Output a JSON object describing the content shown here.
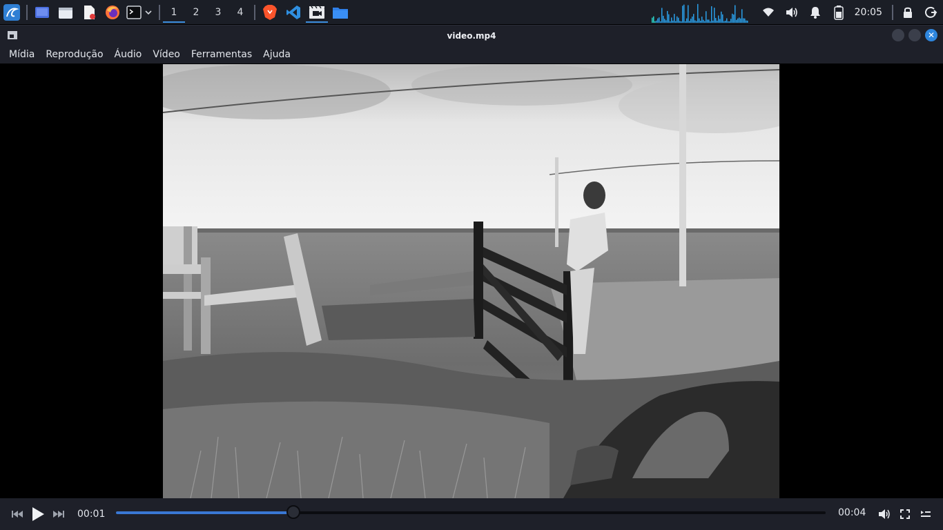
{
  "panel": {
    "workspaces": [
      "1",
      "2",
      "3",
      "4"
    ],
    "active_workspace": "1",
    "clock": "20:05",
    "accent": "#3d8fe0"
  },
  "window": {
    "title": "video.mp4"
  },
  "menubar": {
    "items": [
      "Mídia",
      "Reprodução",
      "Áudio",
      "Vídeo",
      "Ferramentas",
      "Ajuda"
    ]
  },
  "player": {
    "elapsed": "00:01",
    "duration": "00:04",
    "progress": 0.25,
    "seek_color": "#3a78d4"
  },
  "icons": {
    "app_menu": "kali-dragon-icon",
    "workspace_switcher": "desktop-icon",
    "file_manager": "file-manager-icon",
    "text_editor": "text-editor-icon",
    "browser": "firefox-icon",
    "terminal": "terminal-icon",
    "brave": "brave-icon",
    "vscode": "vscode-icon",
    "media_player": "media-player-icon",
    "folder": "folder-icon",
    "network": "wifi-icon",
    "volume": "volume-icon",
    "notifications": "bell-icon",
    "battery": "battery-icon",
    "lock": "lock-icon",
    "logout": "power-icon"
  }
}
